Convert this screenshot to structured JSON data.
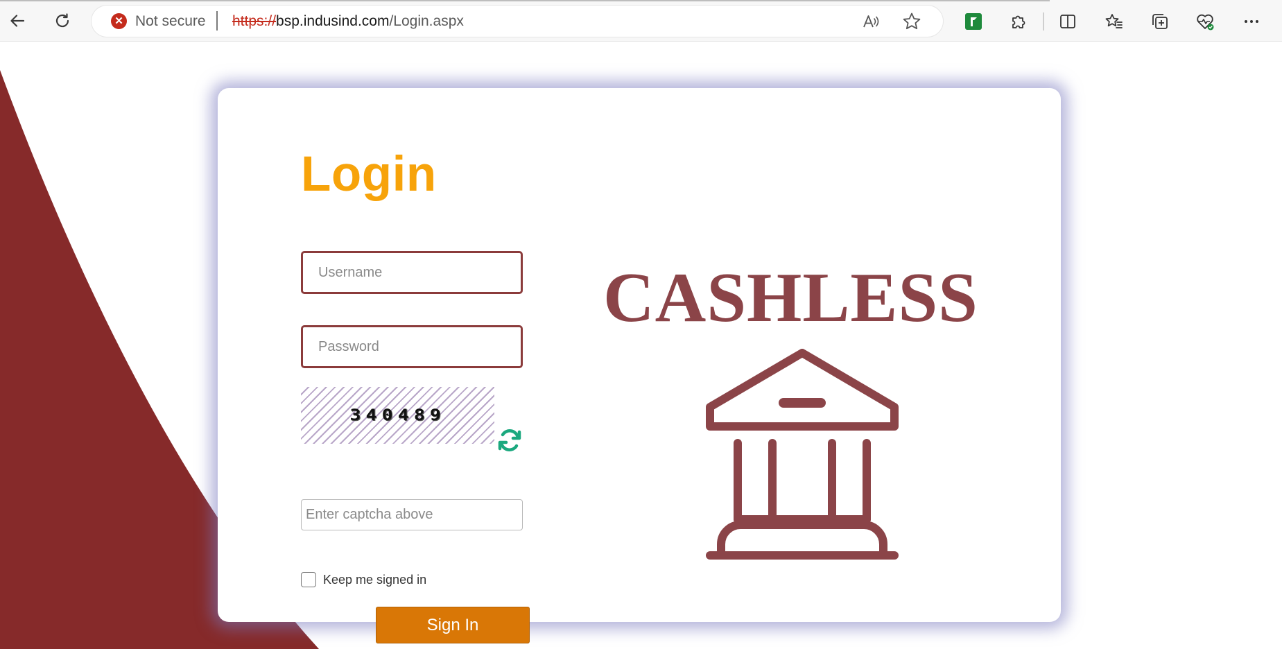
{
  "browser": {
    "security_label": "Not secure",
    "url_scheme": "https://",
    "url_host": "bsp.indusind.com",
    "url_path": "/Login.aspx"
  },
  "login": {
    "title": "Login",
    "username_placeholder": "Username",
    "password_placeholder": "Password",
    "captcha_code": "340489",
    "captcha_placeholder": "Enter captcha above",
    "keep_signed_in_label": "Keep me signed in",
    "sign_in_label": "Sign In"
  },
  "brand": {
    "wordmark": "CASHLESS",
    "icon": "bank-icon"
  },
  "colors": {
    "title": "#f7a30a",
    "accent": "#8b3b3b",
    "button": "#d97706",
    "background_swoosh": "#862a2a",
    "wordmark": "#8b4448",
    "refresh_icon": "#1aa87e"
  }
}
